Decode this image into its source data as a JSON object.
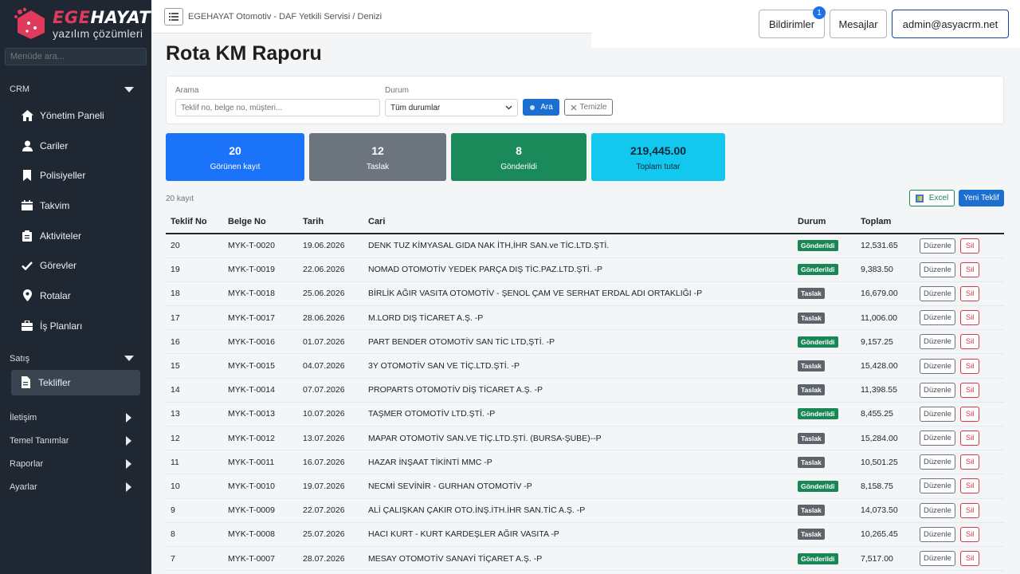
{
  "brand": {
    "title_part1": "EGE",
    "title_part2": "HAYAT",
    "subtitle": "yazılım çözümleri"
  },
  "sidebar": {
    "search_placeholder": "Menüde ara...",
    "sections": [
      {
        "label": "CRM",
        "expanded": true
      },
      {
        "label": "Satış",
        "expanded": true
      },
      {
        "label": "İletişim",
        "expanded": false
      },
      {
        "label": "Temel Tanımlar",
        "expanded": false
      },
      {
        "label": "Raporlar",
        "expanded": false
      },
      {
        "label": "Ayarlar",
        "expanded": false
      }
    ],
    "crm_items": [
      {
        "label": "Yönetim Paneli",
        "icon": "home-icon"
      },
      {
        "label": "Cariler",
        "icon": "user-icon"
      },
      {
        "label": "Polisiyeller",
        "icon": "bookmark-icon"
      },
      {
        "label": "Takvim",
        "icon": "calendar-icon"
      },
      {
        "label": "Aktiviteler",
        "icon": "clipboard-icon"
      },
      {
        "label": "Görevler",
        "icon": "check-icon"
      },
      {
        "label": "Rotalar",
        "icon": "map-pin-icon"
      },
      {
        "label": "İş Planları",
        "icon": "briefcase-icon"
      }
    ],
    "satis_items": [
      {
        "label": "Teklifler",
        "icon": "file-icon",
        "active": true
      }
    ]
  },
  "topbar": {
    "breadcrumb": "EGEHAYAT Otomotiv - DAF Yetkili Servisi / Denizi",
    "notifications_label": "Bildirimler",
    "notifications_count": "1",
    "messages_label": "Mesajlar",
    "user_label": "admin@asyacrm.net"
  },
  "page": {
    "title": "Rota KM Raporu"
  },
  "filters": {
    "search_label": "Arama",
    "search_placeholder": "Teklif no, belge no, müşteri...",
    "status_label": "Durum",
    "status_value": "Tüm durumlar",
    "search_button": "Ara",
    "clear_button": "Temizle"
  },
  "stats": [
    {
      "value": "20",
      "label": "Görünen kayıt",
      "color": "#1a73f8"
    },
    {
      "value": "12",
      "label": "Taslak",
      "color": "#6c757d"
    },
    {
      "value": "8",
      "label": "Gönderildi",
      "color": "#1b8a5a"
    },
    {
      "value": "219,445.00",
      "label": "Toplam tutar",
      "color": "#12c8ef"
    }
  ],
  "list": {
    "count_text": "20 kayıt",
    "excel_button": "Excel",
    "new_button": "Yeni Teklif",
    "edit_label": "Düzenle",
    "delete_label": "Sil",
    "columns": [
      "Teklif No",
      "Belge No",
      "Tarih",
      "Cari",
      "Durum",
      "Toplam",
      ""
    ],
    "rows": [
      {
        "no": "20",
        "belge": "MYK-T-0020",
        "tarih": "19.06.2026",
        "cari": "DENK TUZ KİMYASAL GIDA NAK İTH,İHR SAN.ve TİC.LTD.ŞTİ.",
        "durum": "Gönderildi",
        "toplam": "12,531.65"
      },
      {
        "no": "19",
        "belge": "MYK-T-0019",
        "tarih": "22.06.2026",
        "cari": "NOMAD OTOMOTİV YEDEK PARÇA DIŞ TİC.PAZ.LTD.ŞTİ. -P",
        "durum": "Gönderildi",
        "toplam": "9,383.50"
      },
      {
        "no": "18",
        "belge": "MYK-T-0018",
        "tarih": "25.06.2026",
        "cari": "BİRLİK AĞIR VASITA OTOMOTİV - ŞENOL ÇAM VE SERHAT ERDAL ADI ORTAKLIĞI -P",
        "durum": "Taslak",
        "toplam": "16,679.00"
      },
      {
        "no": "17",
        "belge": "MYK-T-0017",
        "tarih": "28.06.2026",
        "cari": "M.LORD DIŞ TİCARET A.Ş. -P",
        "durum": "Taslak",
        "toplam": "11,006.00"
      },
      {
        "no": "16",
        "belge": "MYK-T-0016",
        "tarih": "01.07.2026",
        "cari": "PART BENDER OTOMOTİV SAN TİC LTD,ŞTİ. -P",
        "durum": "Gönderildi",
        "toplam": "9,157.25"
      },
      {
        "no": "15",
        "belge": "MYK-T-0015",
        "tarih": "04.07.2026",
        "cari": "3Y OTOMOTİV SAN VE TİÇ.LTD.ŞTİ. -P",
        "durum": "Taslak",
        "toplam": "15,428.00"
      },
      {
        "no": "14",
        "belge": "MYK-T-0014",
        "tarih": "07.07.2026",
        "cari": "PROPARTS OTOMOTİV DİŞ TİCARET A.Ş. -P",
        "durum": "Taslak",
        "toplam": "11,398.55"
      },
      {
        "no": "13",
        "belge": "MYK-T-0013",
        "tarih": "10.07.2026",
        "cari": "TAŞMER OTOMOTİV LTD.ŞTİ. -P",
        "durum": "Gönderildi",
        "toplam": "8,455.25"
      },
      {
        "no": "12",
        "belge": "MYK-T-0012",
        "tarih": "13.07.2026",
        "cari": "MAPAR OTOMOTİV SAN.VE TİÇ.LTD.ŞTİ. (BURSA-ŞUBE)--P",
        "durum": "Taslak",
        "toplam": "15,284.00"
      },
      {
        "no": "11",
        "belge": "MYK-T-0011",
        "tarih": "16.07.2026",
        "cari": "HAZAR İNŞAAT TİKİNTİ MMC -P",
        "durum": "Taslak",
        "toplam": "10,501.25"
      },
      {
        "no": "10",
        "belge": "MYK-T-0010",
        "tarih": "19.07.2026",
        "cari": "NECMİ SEVİNİR - GURHAN OTOMOTİV -P",
        "durum": "Gönderildi",
        "toplam": "8,158.75"
      },
      {
        "no": "9",
        "belge": "MYK-T-0009",
        "tarih": "22.07.2026",
        "cari": "ALİ ÇALIŞKAN ÇAKIR OTO.İNŞ.İTH.İHR SAN.TİC A.Ş. -P",
        "durum": "Taslak",
        "toplam": "14,073.50"
      },
      {
        "no": "8",
        "belge": "MYK-T-0008",
        "tarih": "25.07.2026",
        "cari": "HACI KURT - KURT KARDEŞLER AĞIR VASITA -P",
        "durum": "Taslak",
        "toplam": "10,265.45"
      },
      {
        "no": "7",
        "belge": "MYK-T-0007",
        "tarih": "28.07.2026",
        "cari": "MESAY OTOMOTİV SANAYİ TİÇARET A.Ş. -P",
        "durum": "Gönderildi",
        "toplam": "7,517.00"
      }
    ]
  }
}
